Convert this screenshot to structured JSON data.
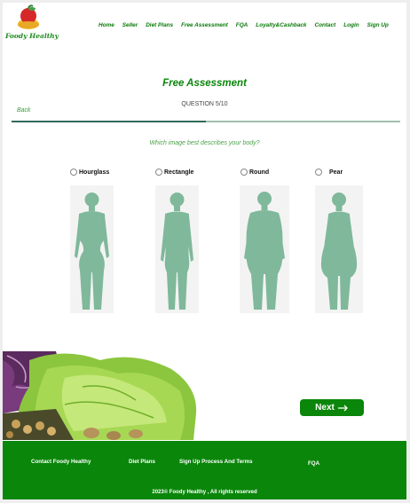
{
  "brand": {
    "name": "Foody Healthy"
  },
  "nav": {
    "items": [
      "Home",
      "Seller",
      "Diet Plans",
      "Free Assessment",
      "FQA",
      "Loyalty&Cashback",
      "Contact",
      "Login",
      "Sign Up"
    ]
  },
  "assessment": {
    "title": "Free Assessment",
    "question_count": "QUESTION 5/10",
    "back_label": "Back",
    "progress": 0.5,
    "question": "Which image best describes your body?",
    "options": [
      {
        "label": "Hourglass",
        "selected": false
      },
      {
        "label": "Rectangle",
        "selected": false
      },
      {
        "label": "Round",
        "selected": false
      },
      {
        "label": "Pear",
        "selected": false
      }
    ],
    "next_label": "Next"
  },
  "footer": {
    "links": [
      "Contact Foody Healthy",
      "Diet Plans",
      "Sign Up Process And Terms",
      "FQA"
    ],
    "copyright": "2023© Foody Healthy , All rights reserved"
  },
  "colors": {
    "brand_green": "#0a860a",
    "silhouette": "#7fb89a",
    "progress_track": "#9fbfae",
    "progress_fill": "#2f6a5a"
  }
}
